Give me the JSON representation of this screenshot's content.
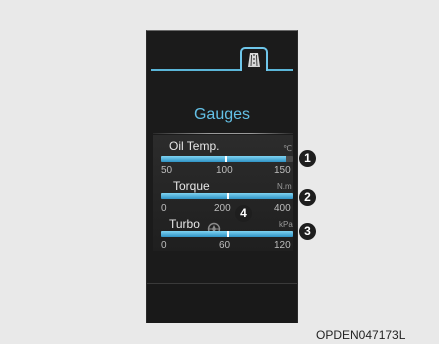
{
  "screen": {
    "title": "Gauges",
    "tab_icon": "road-lanes-icon"
  },
  "gauges": [
    {
      "label": "Oil Temp.",
      "unit": "℃",
      "ticks": [
        "50",
        "100",
        "150"
      ],
      "level_fraction": 0.95
    },
    {
      "label": "Torque",
      "unit": "N.m",
      "ticks": [
        "0",
        "200",
        "400"
      ],
      "level_fraction": 1.0
    },
    {
      "label": "Turbo",
      "unit": "kPa",
      "ticks": [
        "0",
        "60",
        "120"
      ],
      "level_fraction": 1.0,
      "icon": "turbo-icon"
    }
  ],
  "callouts": [
    "1",
    "2",
    "3",
    "4"
  ],
  "image_code": "OPDEN047173L",
  "colors": {
    "accent": "#63c0e6",
    "background": "#1b1b1b",
    "page": "#e9e9e9"
  }
}
